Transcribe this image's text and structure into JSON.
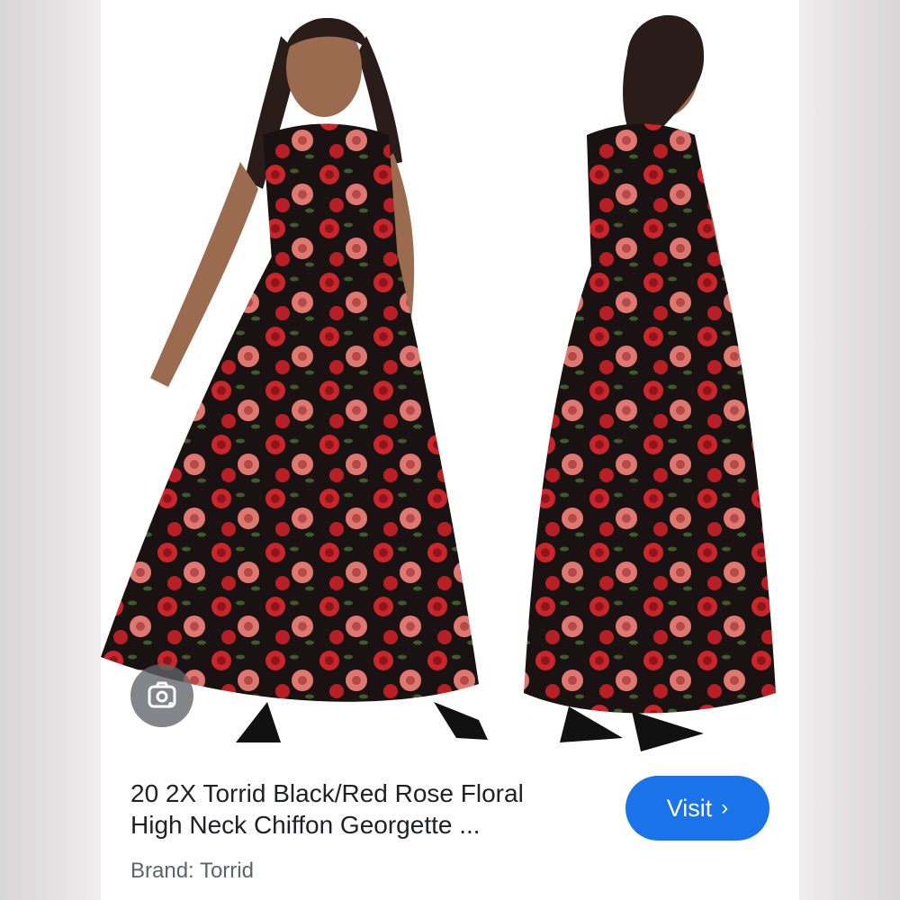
{
  "listing": {
    "title_line1": "20 2X Torrid Black/Red Rose Floral",
    "title_line2": "High Neck Chiffon Georgette ...",
    "brand": "Brand: Torrid",
    "visit_label": "Visit",
    "visit_chevron": "›"
  },
  "icons": {
    "lens": "google-lens-icon",
    "chevron": "chevron-right-icon"
  },
  "colors": {
    "visit_button": "#1a73e8",
    "title_text": "#202124",
    "brand_text": "#5f6368",
    "dress_base": "#1a1212",
    "rose_red": "#c8262b",
    "rose_pink": "#e07872"
  }
}
